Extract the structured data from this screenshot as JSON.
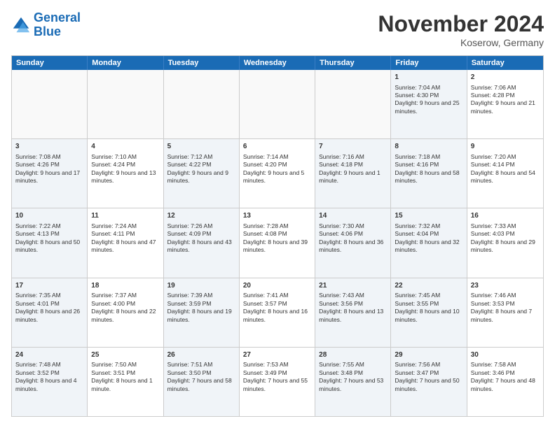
{
  "logo": {
    "line1": "General",
    "line2": "Blue"
  },
  "title": "November 2024",
  "location": "Koserow, Germany",
  "days_of_week": [
    "Sunday",
    "Monday",
    "Tuesday",
    "Wednesday",
    "Thursday",
    "Friday",
    "Saturday"
  ],
  "rows": [
    [
      {
        "day": "",
        "empty": true
      },
      {
        "day": "",
        "empty": true
      },
      {
        "day": "",
        "empty": true
      },
      {
        "day": "",
        "empty": true
      },
      {
        "day": "",
        "empty": true
      },
      {
        "day": "1",
        "sunrise": "Sunrise: 7:04 AM",
        "sunset": "Sunset: 4:30 PM",
        "daylight": "Daylight: 9 hours and 25 minutes.",
        "shaded": true
      },
      {
        "day": "2",
        "sunrise": "Sunrise: 7:06 AM",
        "sunset": "Sunset: 4:28 PM",
        "daylight": "Daylight: 9 hours and 21 minutes.",
        "shaded": false
      }
    ],
    [
      {
        "day": "3",
        "sunrise": "Sunrise: 7:08 AM",
        "sunset": "Sunset: 4:26 PM",
        "daylight": "Daylight: 9 hours and 17 minutes.",
        "shaded": true
      },
      {
        "day": "4",
        "sunrise": "Sunrise: 7:10 AM",
        "sunset": "Sunset: 4:24 PM",
        "daylight": "Daylight: 9 hours and 13 minutes.",
        "shaded": false
      },
      {
        "day": "5",
        "sunrise": "Sunrise: 7:12 AM",
        "sunset": "Sunset: 4:22 PM",
        "daylight": "Daylight: 9 hours and 9 minutes.",
        "shaded": true
      },
      {
        "day": "6",
        "sunrise": "Sunrise: 7:14 AM",
        "sunset": "Sunset: 4:20 PM",
        "daylight": "Daylight: 9 hours and 5 minutes.",
        "shaded": false
      },
      {
        "day": "7",
        "sunrise": "Sunrise: 7:16 AM",
        "sunset": "Sunset: 4:18 PM",
        "daylight": "Daylight: 9 hours and 1 minute.",
        "shaded": true
      },
      {
        "day": "8",
        "sunrise": "Sunrise: 7:18 AM",
        "sunset": "Sunset: 4:16 PM",
        "daylight": "Daylight: 8 hours and 58 minutes.",
        "shaded": true
      },
      {
        "day": "9",
        "sunrise": "Sunrise: 7:20 AM",
        "sunset": "Sunset: 4:14 PM",
        "daylight": "Daylight: 8 hours and 54 minutes.",
        "shaded": false
      }
    ],
    [
      {
        "day": "10",
        "sunrise": "Sunrise: 7:22 AM",
        "sunset": "Sunset: 4:13 PM",
        "daylight": "Daylight: 8 hours and 50 minutes.",
        "shaded": true
      },
      {
        "day": "11",
        "sunrise": "Sunrise: 7:24 AM",
        "sunset": "Sunset: 4:11 PM",
        "daylight": "Daylight: 8 hours and 47 minutes.",
        "shaded": false
      },
      {
        "day": "12",
        "sunrise": "Sunrise: 7:26 AM",
        "sunset": "Sunset: 4:09 PM",
        "daylight": "Daylight: 8 hours and 43 minutes.",
        "shaded": true
      },
      {
        "day": "13",
        "sunrise": "Sunrise: 7:28 AM",
        "sunset": "Sunset: 4:08 PM",
        "daylight": "Daylight: 8 hours and 39 minutes.",
        "shaded": false
      },
      {
        "day": "14",
        "sunrise": "Sunrise: 7:30 AM",
        "sunset": "Sunset: 4:06 PM",
        "daylight": "Daylight: 8 hours and 36 minutes.",
        "shaded": true
      },
      {
        "day": "15",
        "sunrise": "Sunrise: 7:32 AM",
        "sunset": "Sunset: 4:04 PM",
        "daylight": "Daylight: 8 hours and 32 minutes.",
        "shaded": true
      },
      {
        "day": "16",
        "sunrise": "Sunrise: 7:33 AM",
        "sunset": "Sunset: 4:03 PM",
        "daylight": "Daylight: 8 hours and 29 minutes.",
        "shaded": false
      }
    ],
    [
      {
        "day": "17",
        "sunrise": "Sunrise: 7:35 AM",
        "sunset": "Sunset: 4:01 PM",
        "daylight": "Daylight: 8 hours and 26 minutes.",
        "shaded": true
      },
      {
        "day": "18",
        "sunrise": "Sunrise: 7:37 AM",
        "sunset": "Sunset: 4:00 PM",
        "daylight": "Daylight: 8 hours and 22 minutes.",
        "shaded": false
      },
      {
        "day": "19",
        "sunrise": "Sunrise: 7:39 AM",
        "sunset": "Sunset: 3:59 PM",
        "daylight": "Daylight: 8 hours and 19 minutes.",
        "shaded": true
      },
      {
        "day": "20",
        "sunrise": "Sunrise: 7:41 AM",
        "sunset": "Sunset: 3:57 PM",
        "daylight": "Daylight: 8 hours and 16 minutes.",
        "shaded": false
      },
      {
        "day": "21",
        "sunrise": "Sunrise: 7:43 AM",
        "sunset": "Sunset: 3:56 PM",
        "daylight": "Daylight: 8 hours and 13 minutes.",
        "shaded": true
      },
      {
        "day": "22",
        "sunrise": "Sunrise: 7:45 AM",
        "sunset": "Sunset: 3:55 PM",
        "daylight": "Daylight: 8 hours and 10 minutes.",
        "shaded": true
      },
      {
        "day": "23",
        "sunrise": "Sunrise: 7:46 AM",
        "sunset": "Sunset: 3:53 PM",
        "daylight": "Daylight: 8 hours and 7 minutes.",
        "shaded": false
      }
    ],
    [
      {
        "day": "24",
        "sunrise": "Sunrise: 7:48 AM",
        "sunset": "Sunset: 3:52 PM",
        "daylight": "Daylight: 8 hours and 4 minutes.",
        "shaded": true
      },
      {
        "day": "25",
        "sunrise": "Sunrise: 7:50 AM",
        "sunset": "Sunset: 3:51 PM",
        "daylight": "Daylight: 8 hours and 1 minute.",
        "shaded": false
      },
      {
        "day": "26",
        "sunrise": "Sunrise: 7:51 AM",
        "sunset": "Sunset: 3:50 PM",
        "daylight": "Daylight: 7 hours and 58 minutes.",
        "shaded": true
      },
      {
        "day": "27",
        "sunrise": "Sunrise: 7:53 AM",
        "sunset": "Sunset: 3:49 PM",
        "daylight": "Daylight: 7 hours and 55 minutes.",
        "shaded": false
      },
      {
        "day": "28",
        "sunrise": "Sunrise: 7:55 AM",
        "sunset": "Sunset: 3:48 PM",
        "daylight": "Daylight: 7 hours and 53 minutes.",
        "shaded": true
      },
      {
        "day": "29",
        "sunrise": "Sunrise: 7:56 AM",
        "sunset": "Sunset: 3:47 PM",
        "daylight": "Daylight: 7 hours and 50 minutes.",
        "shaded": true
      },
      {
        "day": "30",
        "sunrise": "Sunrise: 7:58 AM",
        "sunset": "Sunset: 3:46 PM",
        "daylight": "Daylight: 7 hours and 48 minutes.",
        "shaded": false
      }
    ]
  ]
}
